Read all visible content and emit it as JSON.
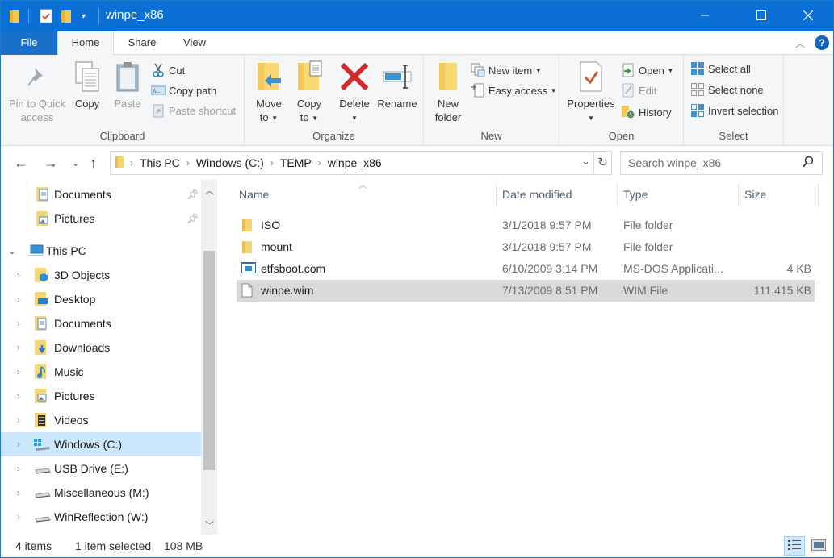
{
  "window": {
    "title": "winpe_x86",
    "controls": {
      "minimize": "minimize-icon",
      "maximize": "maximize-icon",
      "close": "close-icon"
    }
  },
  "quick_access_toolbar": [
    "folder-icon",
    "properties-icon",
    "new-folder-icon",
    "customize-dropdown-icon"
  ],
  "ribbon_tabs": [
    {
      "label": "File"
    },
    {
      "label": "Home",
      "active": true
    },
    {
      "label": "Share"
    },
    {
      "label": "View"
    }
  ],
  "ribbon": {
    "clipboard": {
      "label": "Clipboard",
      "pin_line1": "Pin to Quick",
      "pin_line2": "access",
      "copy": "Copy",
      "paste": "Paste",
      "cut": "Cut",
      "copy_path": "Copy path",
      "paste_shortcut": "Paste shortcut"
    },
    "organize": {
      "label": "Organize",
      "move_line1": "Move",
      "move_line2": "to",
      "copy_line1": "Copy",
      "copy_line2": "to",
      "delete": "Delete",
      "rename": "Rename"
    },
    "new": {
      "label": "New",
      "new_folder_line1": "New",
      "new_folder_line2": "folder",
      "new_item": "New item",
      "easy_access": "Easy access"
    },
    "open": {
      "label": "Open",
      "properties": "Properties",
      "open": "Open",
      "edit": "Edit",
      "history": "History"
    },
    "select": {
      "label": "Select",
      "select_all": "Select all",
      "select_none": "Select none",
      "invert_selection": "Invert selection"
    }
  },
  "address_bar": {
    "breadcrumb": [
      "This PC",
      "Windows (C:)",
      "TEMP",
      "winpe_x86"
    ]
  },
  "search": {
    "placeholder": "Search winpe_x86"
  },
  "nav_pane": {
    "quick_access": [
      {
        "label": "Documents",
        "icon": "documents-icon",
        "pinned": true
      },
      {
        "label": "Pictures",
        "icon": "pictures-icon",
        "pinned": true
      }
    ],
    "this_pc": {
      "label": "This PC",
      "expanded": true
    },
    "children": [
      {
        "label": "3D Objects",
        "icon": "3d-objects-icon"
      },
      {
        "label": "Desktop",
        "icon": "desktop-icon"
      },
      {
        "label": "Documents",
        "icon": "documents-icon"
      },
      {
        "label": "Downloads",
        "icon": "downloads-icon"
      },
      {
        "label": "Music",
        "icon": "music-icon"
      },
      {
        "label": "Pictures",
        "icon": "pictures-icon"
      },
      {
        "label": "Videos",
        "icon": "videos-icon"
      },
      {
        "label": "Windows (C:)",
        "icon": "windows-drive-icon",
        "selected": true
      },
      {
        "label": "USB Drive (E:)",
        "icon": "drive-icon"
      },
      {
        "label": "Miscellaneous (M:)",
        "icon": "drive-icon"
      },
      {
        "label": "WinReflection (W:)",
        "icon": "drive-icon"
      }
    ]
  },
  "file_list": {
    "columns": [
      "Name",
      "Date modified",
      "Type",
      "Size"
    ],
    "sorted_by": "Name",
    "rows": [
      {
        "name": "ISO",
        "date": "3/1/2018 9:57 PM",
        "type": "File folder",
        "size": "",
        "icon": "folder-icon"
      },
      {
        "name": "mount",
        "date": "3/1/2018 9:57 PM",
        "type": "File folder",
        "size": "",
        "icon": "folder-icon"
      },
      {
        "name": "etfsboot.com",
        "date": "6/10/2009 3:14 PM",
        "type": "MS-DOS Applicati...",
        "size": "4 KB",
        "icon": "application-icon"
      },
      {
        "name": "winpe.wim",
        "date": "7/13/2009 8:51 PM",
        "type": "WIM File",
        "size": "111,415 KB",
        "icon": "file-icon",
        "selected": true
      }
    ]
  },
  "status_bar": {
    "item_count": "4 items",
    "selection": "1 item selected",
    "size": "108 MB"
  },
  "colors": {
    "title_bar": "#0a70d6",
    "file_tab": "#1a6fc9",
    "selection": "#cce8ff",
    "selected_row": "#d9d9d9"
  }
}
